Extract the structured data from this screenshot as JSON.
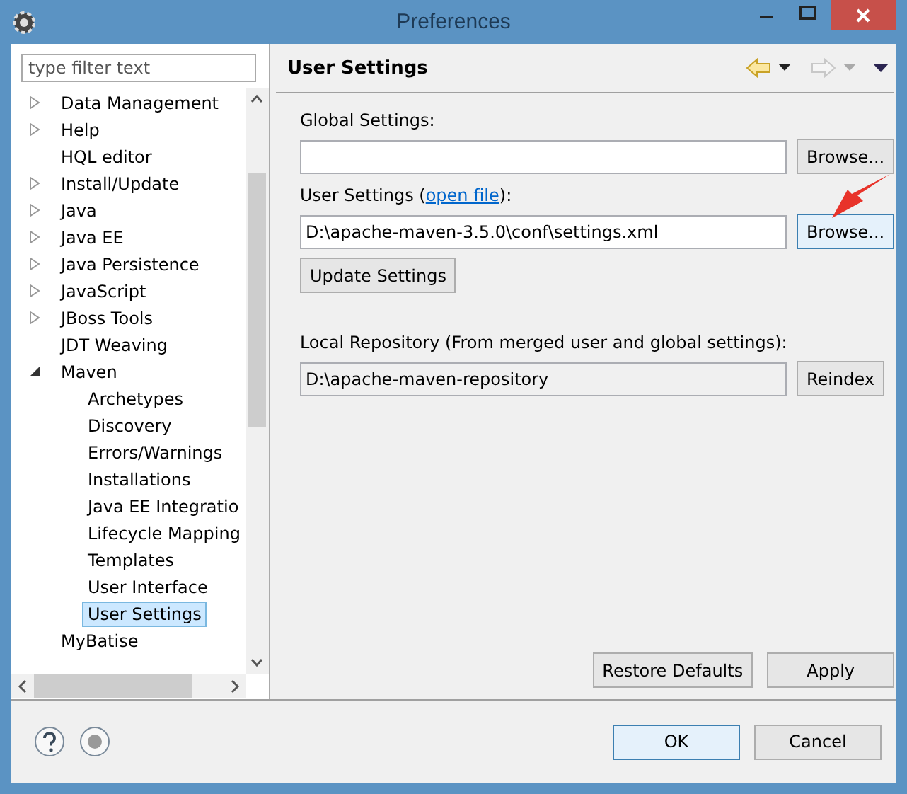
{
  "window": {
    "title": "Preferences"
  },
  "filter": {
    "placeholder": "type filter text"
  },
  "tree": [
    {
      "label": "Data Management",
      "kind": "folder",
      "expanded": false,
      "selected": false
    },
    {
      "label": "Help",
      "kind": "folder",
      "expanded": false,
      "selected": false
    },
    {
      "label": "HQL editor",
      "kind": "leaf",
      "selected": false
    },
    {
      "label": "Install/Update",
      "kind": "folder",
      "expanded": false,
      "selected": false
    },
    {
      "label": "Java",
      "kind": "folder",
      "expanded": false,
      "selected": false
    },
    {
      "label": "Java EE",
      "kind": "folder",
      "expanded": false,
      "selected": false
    },
    {
      "label": "Java Persistence",
      "kind": "folder",
      "expanded": false,
      "selected": false
    },
    {
      "label": "JavaScript",
      "kind": "folder",
      "expanded": false,
      "selected": false
    },
    {
      "label": "JBoss Tools",
      "kind": "folder",
      "expanded": false,
      "selected": false
    },
    {
      "label": "JDT Weaving",
      "kind": "leaf",
      "selected": false
    },
    {
      "label": "Maven",
      "kind": "folder",
      "expanded": true,
      "selected": false,
      "children": [
        {
          "label": "Archetypes",
          "kind": "leaf",
          "selected": false
        },
        {
          "label": "Discovery",
          "kind": "leaf",
          "selected": false
        },
        {
          "label": "Errors/Warnings",
          "kind": "leaf",
          "selected": false
        },
        {
          "label": "Installations",
          "kind": "leaf",
          "selected": false
        },
        {
          "label": "Java EE Integratio",
          "kind": "leaf",
          "selected": false
        },
        {
          "label": "Lifecycle Mapping",
          "kind": "leaf",
          "selected": false
        },
        {
          "label": "Templates",
          "kind": "leaf",
          "selected": false
        },
        {
          "label": "User Interface",
          "kind": "leaf",
          "selected": false
        },
        {
          "label": "User Settings",
          "kind": "leaf",
          "selected": true
        }
      ]
    },
    {
      "label": "MyBatise",
      "kind": "leaf",
      "selected": false
    }
  ],
  "page": {
    "title": "User Settings",
    "global_settings": {
      "label": "Global Settings:",
      "button": "Browse..."
    },
    "user_settings": {
      "label_before": "User Settings (",
      "link": "open file",
      "label_after": "):",
      "value": "D:\\apache-maven-3.5.0\\conf\\settings.xml",
      "button": "Browse...",
      "button_hovered": true
    },
    "update_button": "Update Settings",
    "local_repository": {
      "label": "Local Repository (From merged user and global settings):",
      "value": "D:\\apache-maven-repository",
      "button": "Reindex"
    },
    "buttons": [
      "Restore Defaults",
      "Apply"
    ]
  },
  "footer": {
    "buttons": [
      {
        "label": "OK",
        "default": true
      },
      {
        "label": "Cancel",
        "default": false
      }
    ]
  }
}
